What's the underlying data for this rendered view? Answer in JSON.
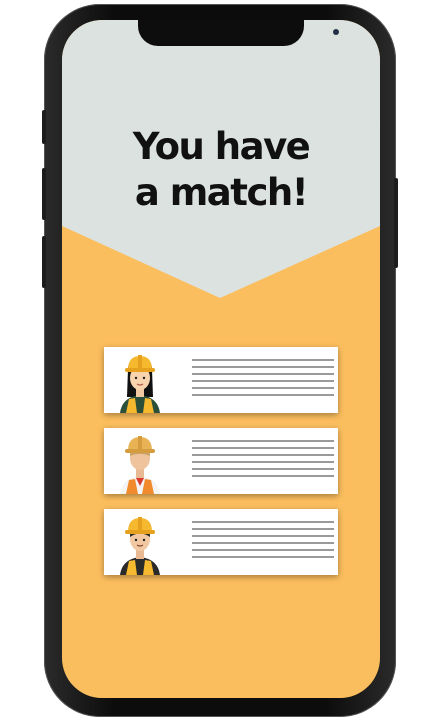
{
  "screen": {
    "headline_line1": "You have",
    "headline_line2": "a match!"
  },
  "colors": {
    "top_panel": "#dce2df",
    "background": "#fbbe5e",
    "card": "#ffffff",
    "text_lines": "#9a9a9a",
    "hard_hat": "#f5b82e"
  },
  "cards": [
    {
      "avatar": "female-worker-avatar"
    },
    {
      "avatar": "faceless-worker-avatar"
    },
    {
      "avatar": "male-worker-avatar"
    }
  ]
}
